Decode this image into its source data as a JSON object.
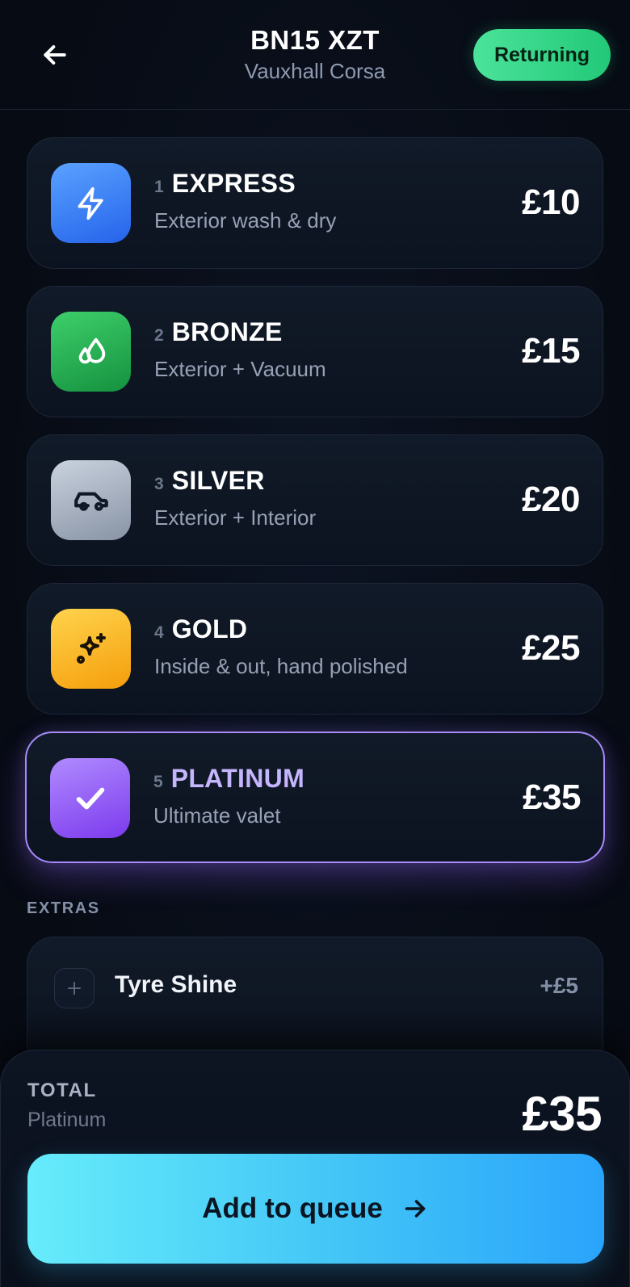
{
  "header": {
    "plate": "BN15 XZT",
    "model": "Vauxhall Corsa",
    "badge": "Returning"
  },
  "packages": [
    {
      "num": "1",
      "name": "EXPRESS",
      "desc": "Exterior wash & dry",
      "price": "£10",
      "icon": "lightning-icon",
      "color": "#3b82f6"
    },
    {
      "num": "2",
      "name": "BRONZE",
      "desc": "Exterior + Vacuum",
      "price": "£15",
      "icon": "droplets-icon",
      "color": "#22a34f"
    },
    {
      "num": "3",
      "name": "SILVER",
      "desc": "Exterior + Interior",
      "price": "£20",
      "icon": "car-icon",
      "color": "#a3adbc"
    },
    {
      "num": "4",
      "name": "GOLD",
      "desc": "Inside & out, hand polished",
      "price": "£25",
      "icon": "sparkle-icon",
      "color": "#fbbf24"
    },
    {
      "num": "5",
      "name": "PLATINUM",
      "desc": "Ultimate valet",
      "price": "£35",
      "icon": "check-icon",
      "color": "#8b5cf6",
      "selected": true
    }
  ],
  "extras": {
    "label": "EXTRAS",
    "items": [
      {
        "name": "Tyre Shine",
        "price": "+£5",
        "icon": "plus-icon"
      }
    ]
  },
  "summary": {
    "label": "TOTAL",
    "package": "Platinum",
    "price": "£35",
    "cta": "Add to queue"
  },
  "colors": {
    "accent": "#a78bfa",
    "cta_start": "#66ecfb",
    "cta_end": "#2aa4fb",
    "badge": "#2fd584"
  }
}
